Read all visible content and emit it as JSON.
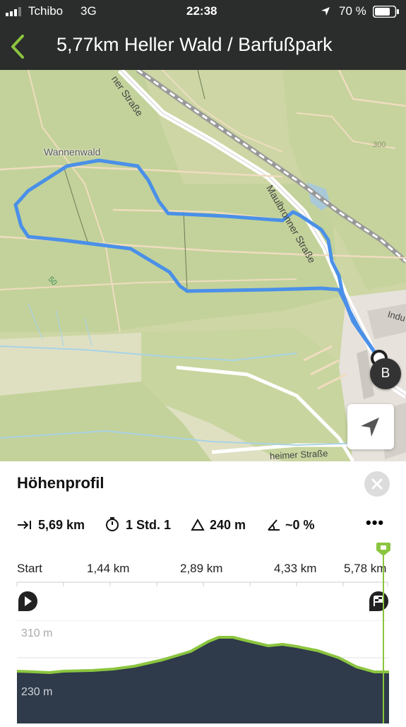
{
  "status_bar": {
    "carrier": "Tchibo",
    "network": "3G",
    "time": "22:38",
    "battery": "70 %"
  },
  "header": {
    "title": "5,77km Heller Wald / Barfußpark"
  },
  "map": {
    "labels": {
      "wannenwald": "Wannenwald",
      "maulbronner_top": "ner Straße",
      "maulbronner": "Maulbronner Straße",
      "contour_300": "300",
      "contour_50": "50",
      "industrie": "Indu",
      "bottom_street": "heimer Straße"
    },
    "marker": "B",
    "route_color": "#4a90e8"
  },
  "panel": {
    "title": "Höhenprofil",
    "stats": {
      "distance": "5,69 km",
      "duration": "1 Std. 1",
      "ascent": "240 m",
      "slope": "~0 %"
    },
    "more": "•••",
    "scale": [
      "Start",
      "1,44 km",
      "2,89 km",
      "4,33 km",
      "5,78 km"
    ],
    "elevation_labels": {
      "top": "310 m",
      "bottom": "230 m"
    },
    "accent_color": "#8bc53f"
  }
}
